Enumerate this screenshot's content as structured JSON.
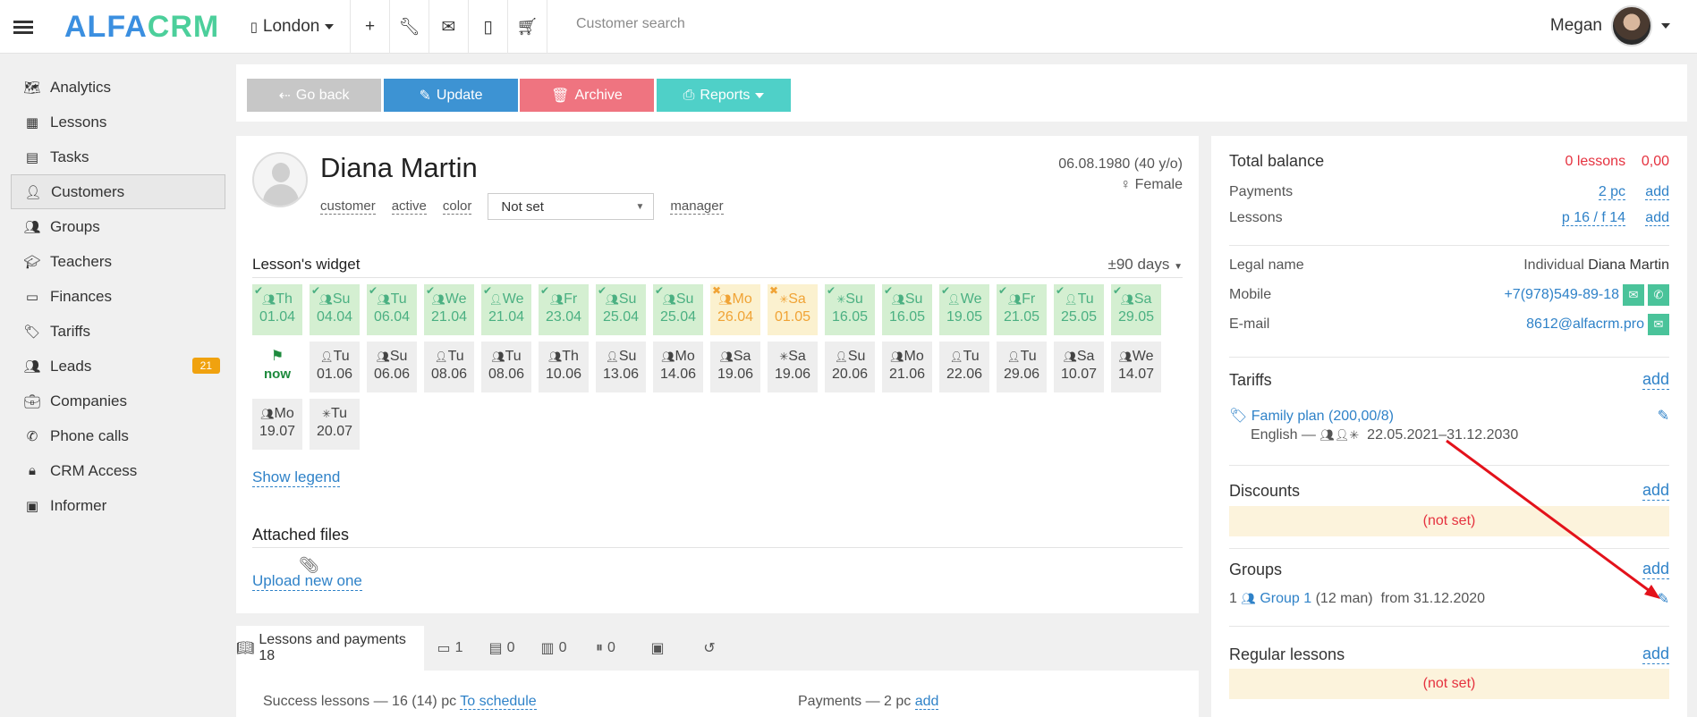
{
  "topbar": {
    "logo_main": "ALFA",
    "logo_accent": "CRM",
    "branch": "London",
    "search_placeholder": "Customer search",
    "user_name": "Megan"
  },
  "sidebar": {
    "items": [
      {
        "label": "Analytics",
        "icon": "map-icon"
      },
      {
        "label": "Lessons",
        "icon": "calendar-icon"
      },
      {
        "label": "Tasks",
        "icon": "clipboard-icon"
      },
      {
        "label": "Customers",
        "icon": "user-icon"
      },
      {
        "label": "Groups",
        "icon": "users-icon"
      },
      {
        "label": "Teachers",
        "icon": "teacher-icon"
      },
      {
        "label": "Finances",
        "icon": "money-icon"
      },
      {
        "label": "Tariffs",
        "icon": "tag-icon"
      },
      {
        "label": "Leads",
        "icon": "user-icon",
        "badge": "21"
      },
      {
        "label": "Companies",
        "icon": "briefcase-icon"
      },
      {
        "label": "Phone calls",
        "icon": "phone-icon"
      },
      {
        "label": "CRM Access",
        "icon": "lock-icon"
      },
      {
        "label": "Informer",
        "icon": "book-icon"
      }
    ]
  },
  "actions": {
    "back": "Go back",
    "update": "Update",
    "archive": "Archive",
    "reports": "Reports"
  },
  "customer": {
    "name": "Diana Martin",
    "dob": "06.08.1980 (40 y/o)",
    "gender": "Female",
    "tag_customer": "customer",
    "tag_active": "active",
    "tag_color": "color",
    "status_select": "Not set",
    "tag_manager": "manager"
  },
  "widget": {
    "title": "Lesson's widget",
    "range": "±90 days",
    "row1": [
      {
        "day": "Th",
        "date": "01.04",
        "state": "green",
        "mark": "✔",
        "icon": "users"
      },
      {
        "day": "Su",
        "date": "04.04",
        "state": "green",
        "mark": "✔",
        "icon": "users"
      },
      {
        "day": "Tu",
        "date": "06.04",
        "state": "green",
        "mark": "✔",
        "icon": "users"
      },
      {
        "day": "We",
        "date": "21.04",
        "state": "green",
        "mark": "✔",
        "icon": "users"
      },
      {
        "day": "We",
        "date": "21.04",
        "state": "green",
        "mark": "✔",
        "icon": "user"
      },
      {
        "day": "Fr",
        "date": "23.04",
        "state": "green",
        "mark": "✔",
        "icon": "users"
      },
      {
        "day": "Su",
        "date": "25.04",
        "state": "green",
        "mark": "✔",
        "icon": "users"
      },
      {
        "day": "Su",
        "date": "25.04",
        "state": "green",
        "mark": "✔",
        "icon": "users"
      },
      {
        "day": "Mo",
        "date": "26.04",
        "state": "yellow",
        "mark": "✖",
        "icon": "users"
      },
      {
        "day": "Sa",
        "date": "01.05",
        "state": "yellow",
        "mark": "✖",
        "icon": "star"
      },
      {
        "day": "Su",
        "date": "16.05",
        "state": "green",
        "mark": "✔",
        "icon": "star"
      },
      {
        "day": "Su",
        "date": "16.05",
        "state": "green",
        "mark": "✔",
        "icon": "users"
      },
      {
        "day": "We",
        "date": "19.05",
        "state": "green",
        "mark": "✔",
        "icon": "user"
      },
      {
        "day": "Fr",
        "date": "21.05",
        "state": "green",
        "mark": "✔",
        "icon": "users"
      },
      {
        "day": "Tu",
        "date": "25.05",
        "state": "green",
        "mark": "✔",
        "icon": "user"
      },
      {
        "day": "Sa",
        "date": "29.05",
        "state": "green",
        "mark": "✔",
        "icon": "users"
      }
    ],
    "now_label": "now",
    "row2": [
      {
        "day": "Tu",
        "date": "01.06",
        "icon": "user"
      },
      {
        "day": "Su",
        "date": "06.06",
        "icon": "users"
      },
      {
        "day": "Tu",
        "date": "08.06",
        "icon": "user"
      },
      {
        "day": "Tu",
        "date": "08.06",
        "icon": "users"
      },
      {
        "day": "Th",
        "date": "10.06",
        "icon": "users"
      },
      {
        "day": "Su",
        "date": "13.06",
        "icon": "user"
      },
      {
        "day": "Mo",
        "date": "14.06",
        "icon": "users"
      },
      {
        "day": "Sa",
        "date": "19.06",
        "icon": "users"
      },
      {
        "day": "Sa",
        "date": "19.06",
        "icon": "star"
      },
      {
        "day": "Su",
        "date": "20.06",
        "icon": "user"
      },
      {
        "day": "Mo",
        "date": "21.06",
        "icon": "users"
      },
      {
        "day": "Tu",
        "date": "22.06",
        "icon": "user"
      },
      {
        "day": "Tu",
        "date": "29.06",
        "icon": "user"
      },
      {
        "day": "Sa",
        "date": "10.07",
        "icon": "users"
      },
      {
        "day": "We",
        "date": "14.07",
        "icon": "users"
      }
    ],
    "row3": [
      {
        "day": "Mo",
        "date": "19.07",
        "icon": "users"
      },
      {
        "day": "Tu",
        "date": "20.07",
        "icon": "star"
      }
    ],
    "legend": "Show legend"
  },
  "files": {
    "title": "Attached files",
    "upload": "Upload new one"
  },
  "tabs": {
    "items": [
      {
        "label": "Lessons and payments 18",
        "icon": "book-icon"
      },
      {
        "label": "1",
        "icon": "comments-icon"
      },
      {
        "label": "0",
        "icon": "clipboard-icon"
      },
      {
        "label": "0",
        "icon": "bar-chart-icon"
      },
      {
        "label": "0",
        "icon": "pause-icon"
      },
      {
        "label": "",
        "icon": "money-icon"
      },
      {
        "label": "",
        "icon": "history-icon"
      }
    ],
    "sub_left": "Success lessons — 16 (14) pc",
    "sub_schedule": "To schedule",
    "sub_payments": "Payments — 2 pc",
    "sub_add": "add"
  },
  "balance": {
    "title": "Total balance",
    "lessons": "0 lessons",
    "amount": "0,00",
    "payments_label": "Payments",
    "payments_value": "2 pc",
    "lessons_label": "Lessons",
    "lessons_value": "p 16 / f 14",
    "add": "add"
  },
  "contacts": {
    "legal_label": "Legal name",
    "legal_type": "Individual",
    "legal_name": "Diana Martin",
    "mobile_label": "Mobile",
    "mobile_value": "+7(978)549-89-18",
    "email_label": "E-mail",
    "email_value": "8612@alfacrm.pro"
  },
  "tariffs": {
    "title": "Tariffs",
    "add": "add",
    "plan": "Family plan (200,00/8)",
    "detail": "English —",
    "period": "22.05.2021–31.12.2030"
  },
  "discounts": {
    "title": "Discounts",
    "add": "add",
    "empty": "(not set)"
  },
  "groups": {
    "title": "Groups",
    "add": "add",
    "count": "1",
    "name": "Group 1",
    "size": "(12 man)",
    "since": "from 31.12.2020"
  },
  "regular": {
    "title": "Regular lessons",
    "add": "add",
    "empty": "(not set)"
  },
  "colors": {
    "brand_blue": "#3b8fe0",
    "brand_green": "#4ccf9b",
    "update": "#3d93d3",
    "archive": "#ef7480",
    "reports": "#4fd0c8",
    "back": "#c7c7c7",
    "badge": "#f0a20f",
    "arrow": "#e3121b"
  }
}
